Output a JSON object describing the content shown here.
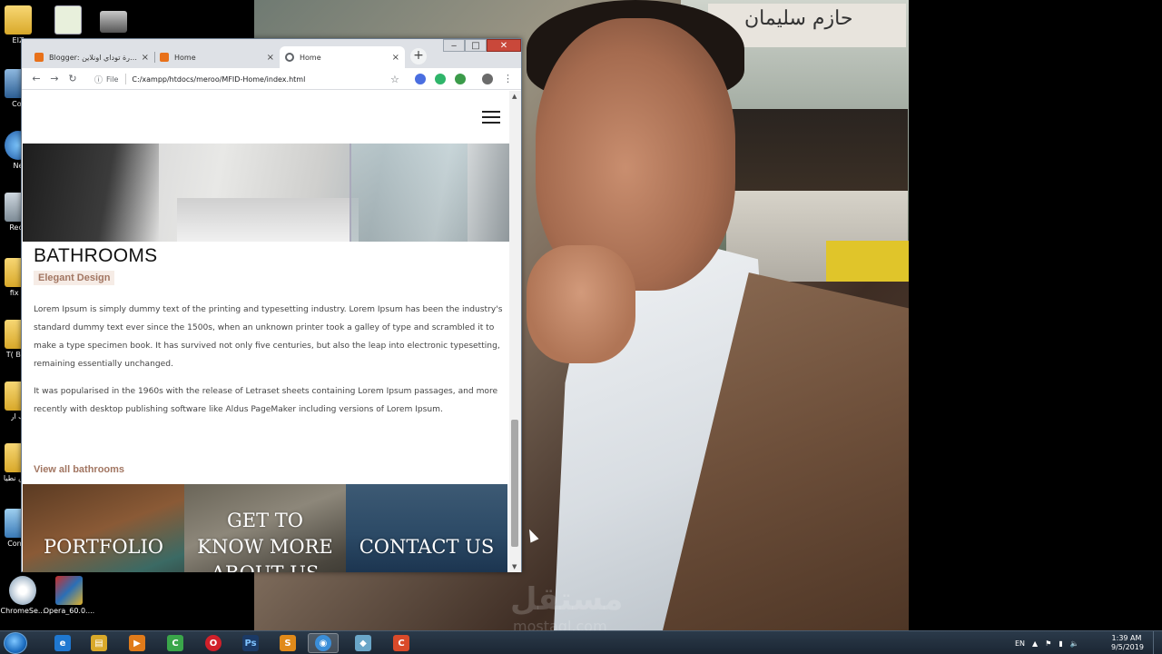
{
  "desktop": {
    "icons": [
      {
        "label": "EIZ",
        "kind": "folder"
      },
      {
        "label": "Cor",
        "kind": "app"
      },
      {
        "label": "Ne",
        "kind": "app"
      },
      {
        "label": "Recy",
        "kind": "app"
      },
      {
        "label": "fix H",
        "kind": "folder"
      },
      {
        "label": "T( Brai",
        "kind": "folder"
      },
      {
        "label": "ف ار",
        "kind": "folder"
      },
      {
        "label": "كاس نطيا",
        "kind": "folder"
      },
      {
        "label": "Conta",
        "kind": "app"
      },
      {
        "label": "ChromeSe...",
        "kind": "app"
      },
      {
        "label": "Opera_60.0....",
        "kind": "app"
      }
    ],
    "wallpaper": {
      "sign_text": "حازم سليمان",
      "watermark": "مستقل",
      "watermark_sub": "mostaql.com"
    }
  },
  "browser": {
    "window_controls": {
      "minimize": "‒",
      "maximize": "□",
      "close": "✕"
    },
    "tabs": [
      {
        "label": "Blogger: كورة توداي اونلاين - ...",
        "favicon_color": "#e8711a",
        "active": false
      },
      {
        "label": "Home",
        "favicon_color": "#e8711a",
        "active": false
      },
      {
        "label": "Home",
        "favicon_color": "#5f6368",
        "active": true
      }
    ],
    "tab_close": "×",
    "new_tab": "+",
    "nav": {
      "back": "←",
      "forward": "→",
      "reload": "↻"
    },
    "omnibox": {
      "info_icon": "ⓘ",
      "scheme_label": "File",
      "url": "C:/xampp/htdocs/meroo/MFID-Home/index.html"
    },
    "star": "☆",
    "menu": "⋮",
    "extension_colors": [
      "#4a6ee0",
      "#2fb56a",
      "#3b9b4a",
      "#6b6b6b"
    ]
  },
  "page": {
    "section_title": "BATHROOMS",
    "badge": "Elegant Design",
    "paragraphs": [
      "Lorem Ipsum is simply dummy text of the printing and typesetting industry. Lorem Ipsum has been the industry's standard dummy text ever since the 1500s, when an unknown printer took a galley of type and scrambled it to make a type specimen book. It has survived not only five centuries, but also the leap into electronic typesetting, remaining essentially unchanged.",
      "It was popularised in the 1960s with the release of Letraset sheets containing Lorem Ipsum passages, and more recently with desktop publishing software like Aldus PageMaker including versions of Lorem Ipsum."
    ],
    "link": "View all bathrooms",
    "tiles": [
      {
        "label": "PORTFOLIO"
      },
      {
        "label": "GET TO KNOW MORE ABOUT US"
      },
      {
        "label": "CONTACT US"
      }
    ],
    "accent_color": "#a27662"
  },
  "taskbar": {
    "items": [
      {
        "name": "ie",
        "glyph": "e",
        "color": "#1f78d1"
      },
      {
        "name": "explorer",
        "glyph": "▤",
        "color": "#d9a92a"
      },
      {
        "name": "media",
        "glyph": "▶",
        "color": "#e07b1a"
      },
      {
        "name": "camtasia",
        "glyph": "C",
        "color": "#3aa64a"
      },
      {
        "name": "opera",
        "glyph": "O",
        "color": "#d1202a"
      },
      {
        "name": "photoshop",
        "glyph": "Ps",
        "color": "#1b3a66"
      },
      {
        "name": "sublime",
        "glyph": "S",
        "color": "#e08a1a"
      },
      {
        "name": "chrome",
        "glyph": "◉",
        "color": "#3b8ed8"
      },
      {
        "name": "app",
        "glyph": "◆",
        "color": "#6aa6c8"
      },
      {
        "name": "camtasia-recorder",
        "glyph": "C",
        "color": "#d94a2a"
      }
    ],
    "language": "EN",
    "time": "1:39 AM",
    "date": "9/5/2019"
  }
}
